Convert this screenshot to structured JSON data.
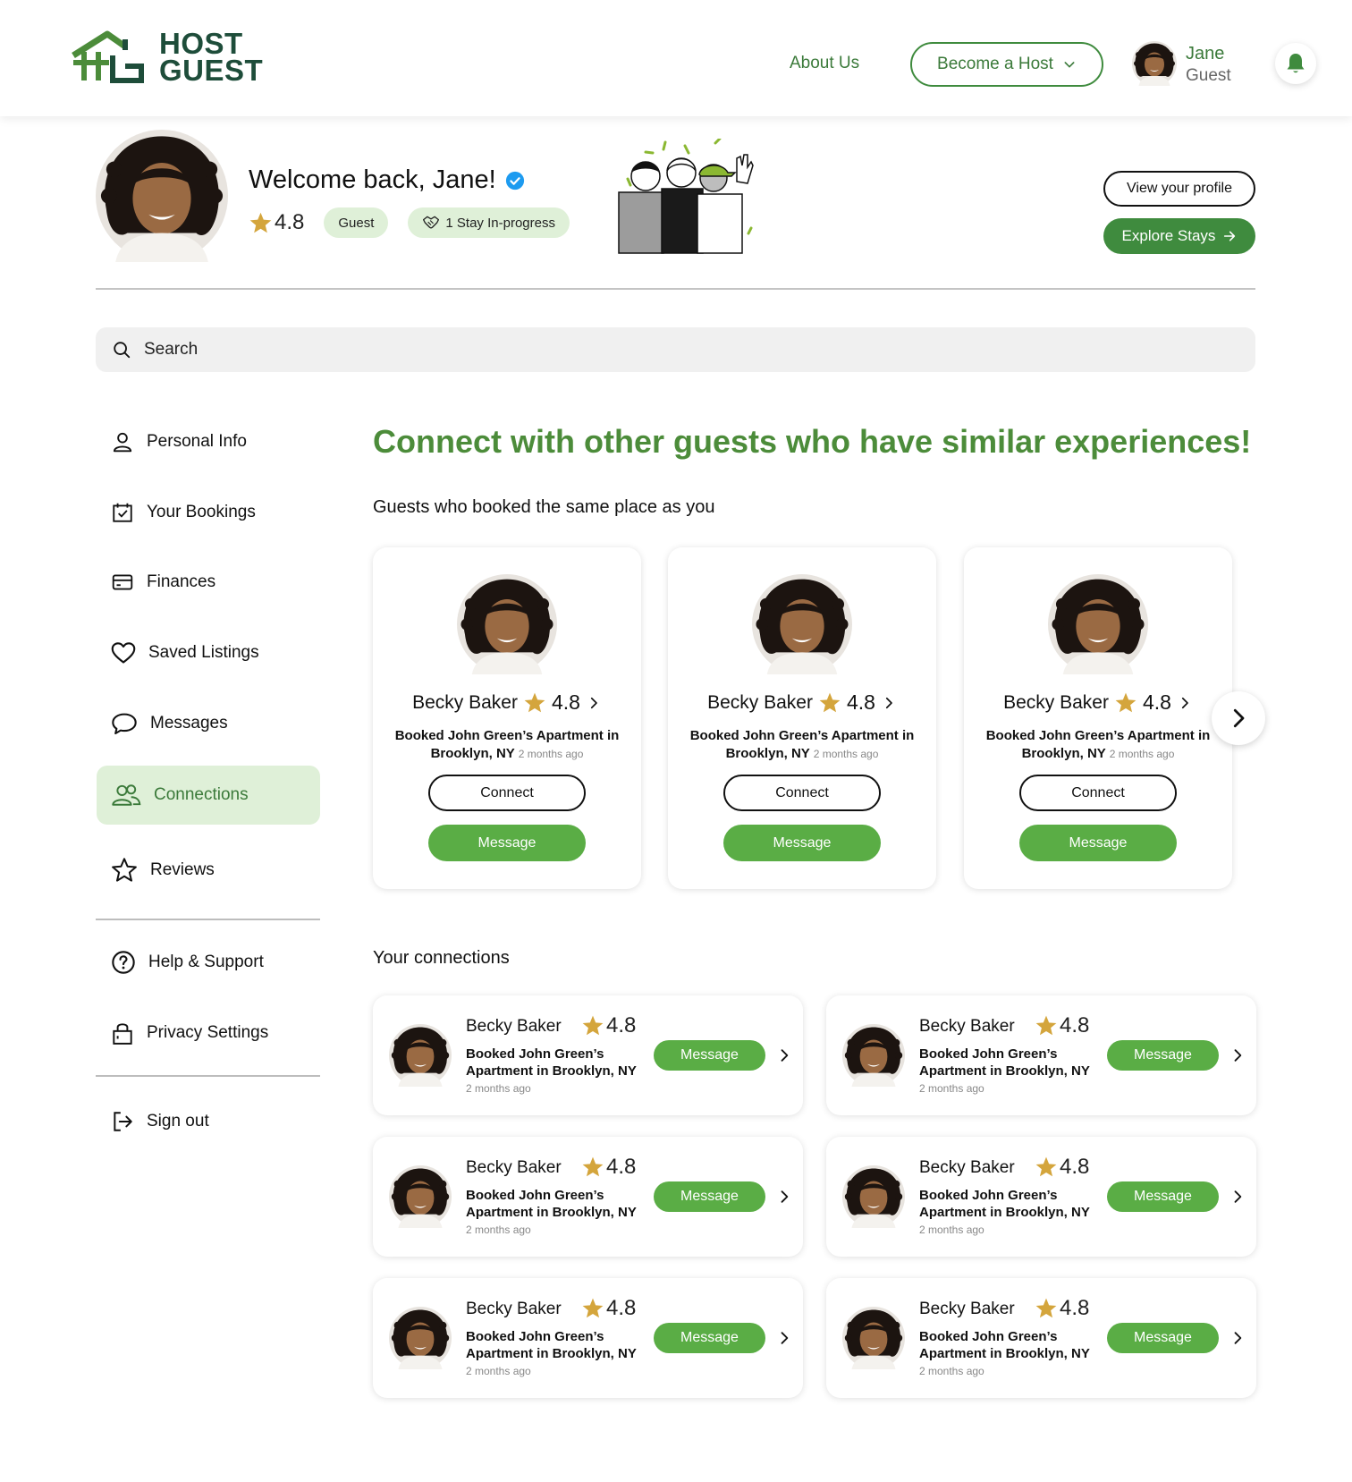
{
  "header": {
    "logo_line1": "HOST",
    "logo_line2": "GUEST",
    "about_label": "About Us",
    "become_host_label": "Become a Host",
    "user_name": "Jane",
    "user_role": "Guest"
  },
  "profile": {
    "welcome": "Welcome back, Jane!",
    "rating": "4.8",
    "role_badge": "Guest",
    "stay_badge": "1 Stay In-progress",
    "view_profile_label": "View your profile",
    "explore_label": "Explore Stays"
  },
  "search": {
    "placeholder": "Search"
  },
  "sidebar": {
    "items": [
      {
        "label": "Personal Info",
        "icon": "user-icon"
      },
      {
        "label": "Your Bookings",
        "icon": "calendar-check-icon"
      },
      {
        "label": "Finances",
        "icon": "credit-card-icon"
      },
      {
        "label": "Saved Listings",
        "icon": "heart-icon"
      },
      {
        "label": "Messages",
        "icon": "chat-bubble-icon"
      },
      {
        "label": "Connections",
        "icon": "users-icon",
        "active": true
      },
      {
        "label": "Reviews",
        "icon": "star-outline-icon"
      }
    ],
    "secondary": [
      {
        "label": "Help & Support",
        "icon": "question-circle-icon"
      },
      {
        "label": "Privacy Settings",
        "icon": "lock-icon"
      }
    ],
    "signout": {
      "label": "Sign out",
      "icon": "sign-out-icon"
    }
  },
  "main": {
    "title": "Connect with other guests who have similar experiences!",
    "same_place_title": "Guests who booked the same place as you",
    "connections_title": "Your connections"
  },
  "guest_cards": [
    {
      "name": "Becky Baker",
      "rating": "4.8",
      "desc": "Booked John Green’s Apartment in Brooklyn, NY",
      "ago": "2 months ago",
      "connect": "Connect",
      "message": "Message"
    },
    {
      "name": "Becky Baker",
      "rating": "4.8",
      "desc": "Booked John Green’s Apartment in Brooklyn, NY",
      "ago": "2 months ago",
      "connect": "Connect",
      "message": "Message"
    },
    {
      "name": "Becky Baker",
      "rating": "4.8",
      "desc": "Booked John Green’s Apartment in Brooklyn, NY",
      "ago": "2 months ago",
      "connect": "Connect",
      "message": "Message"
    }
  ],
  "connections": [
    {
      "name": "Becky Baker",
      "rating": "4.8",
      "desc": "Booked John Green’s Apartment in Brooklyn, NY",
      "ago": "2 months ago",
      "message": "Message"
    },
    {
      "name": "Becky Baker",
      "rating": "4.8",
      "desc": "Booked John Green’s Apartment in Brooklyn, NY",
      "ago": "2 months ago",
      "message": "Message"
    },
    {
      "name": "Becky Baker",
      "rating": "4.8",
      "desc": "Booked John Green’s Apartment in Brooklyn, NY",
      "ago": "2 months ago",
      "message": "Message"
    },
    {
      "name": "Becky Baker",
      "rating": "4.8",
      "desc": "Booked John Green’s Apartment in Brooklyn, NY",
      "ago": "2 months ago",
      "message": "Message"
    },
    {
      "name": "Becky Baker",
      "rating": "4.8",
      "desc": "Booked John Green’s Apartment in Brooklyn, NY",
      "ago": "2 months ago",
      "message": "Message"
    },
    {
      "name": "Becky Baker",
      "rating": "4.8",
      "desc": "Booked John Green’s Apartment in Brooklyn, NY",
      "ago": "2 months ago",
      "message": "Message"
    }
  ],
  "colors": {
    "brand_green": "#3f8b3e",
    "accent_green": "#5aad45",
    "title_green": "#4c8c3a",
    "pill_bg": "#dff0d8",
    "star_gold": "#d4a53c",
    "verified_blue": "#1d9bf0"
  }
}
